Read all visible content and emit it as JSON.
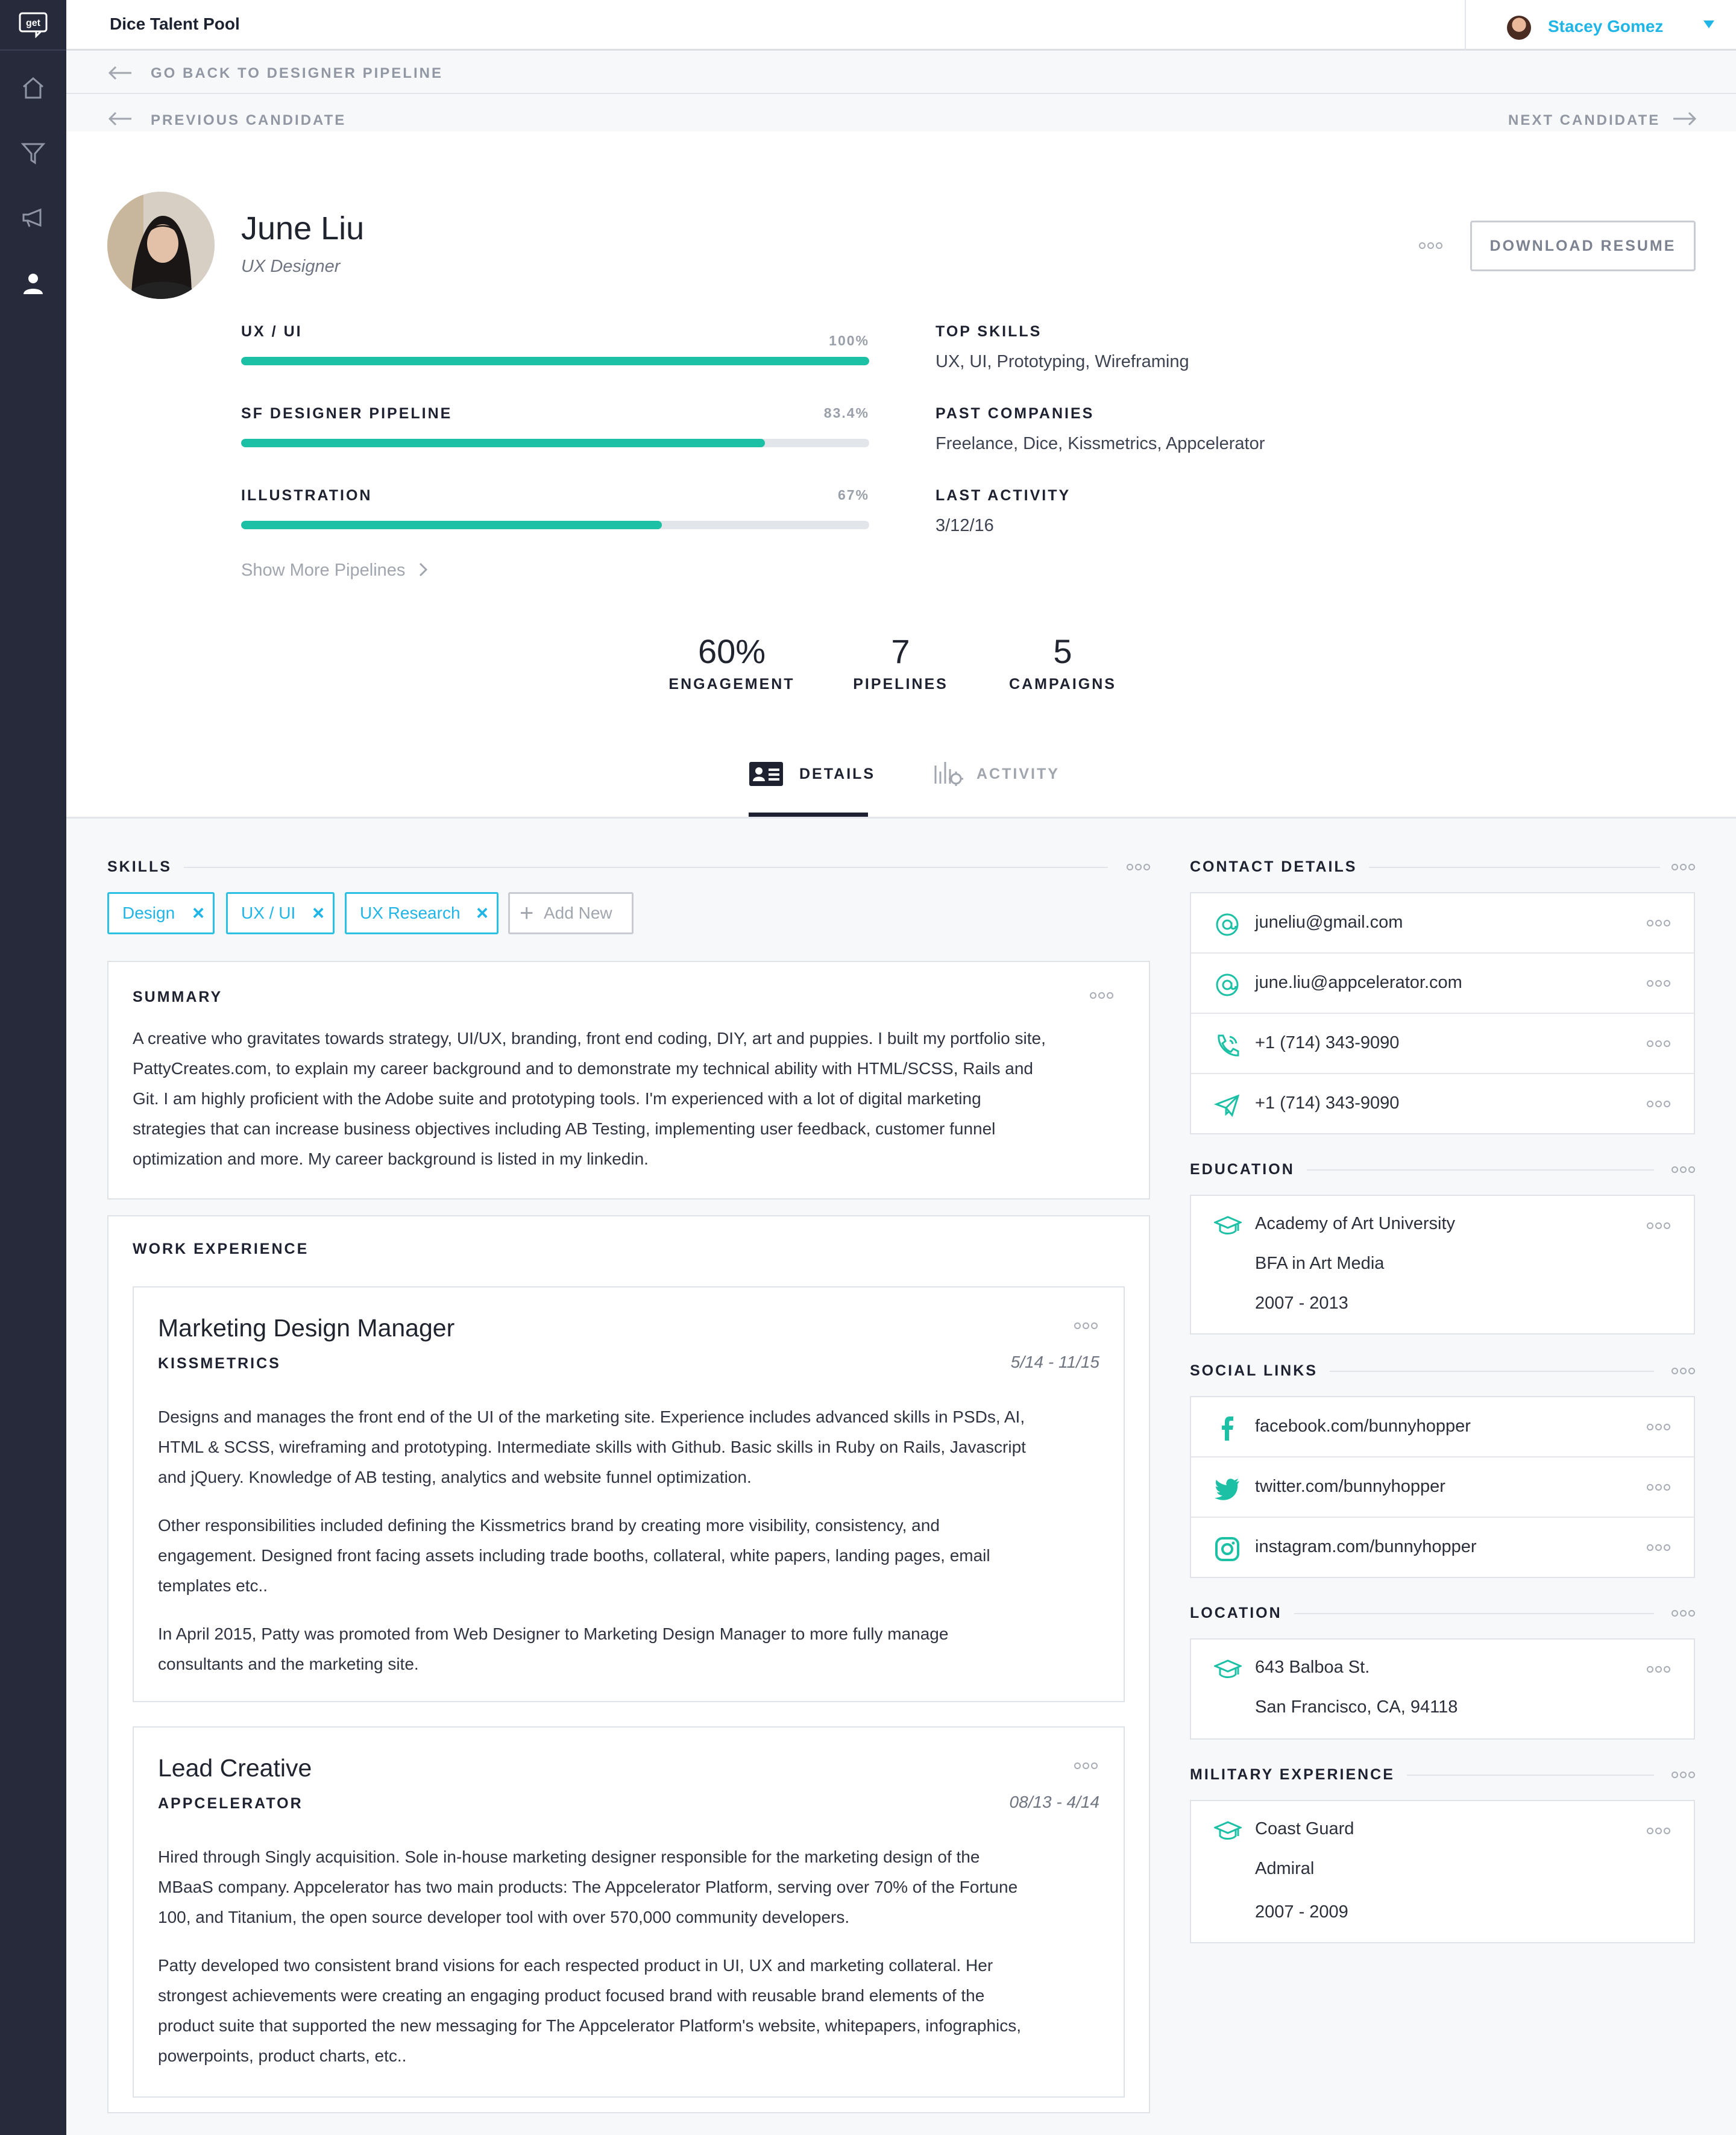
{
  "app": {
    "logo": "get",
    "title": "Dice Talent Pool"
  },
  "user": {
    "name": "Stacey Gomez"
  },
  "nav": {
    "back": "GO BACK TO DESIGNER PIPELINE",
    "prev": "PREVIOUS CANDIDATE",
    "next": "NEXT CANDIDATE"
  },
  "sidebar": {
    "items": [
      {
        "icon": "home-icon"
      },
      {
        "icon": "funnel-icon"
      },
      {
        "icon": "megaphone-icon"
      },
      {
        "icon": "person-icon"
      }
    ]
  },
  "candidate": {
    "name": "June Liu",
    "title": "UX Designer"
  },
  "actions": {
    "download": "DOWNLOAD RESUME"
  },
  "pipelines": [
    {
      "label": "UX / UI",
      "pct_text": "100%",
      "value": 100
    },
    {
      "label": "SF DESIGNER PIPELINE",
      "pct_text": "83.4%",
      "value": 83.4
    },
    {
      "label": "ILLUSTRATION",
      "pct_text": "67%",
      "value": 67
    }
  ],
  "show_more": "Show More Pipelines",
  "info": [
    {
      "label": "TOP SKILLS",
      "value": "UX, UI, Prototyping, Wireframing"
    },
    {
      "label": "PAST COMPANIES",
      "value": "Freelance, Dice, Kissmetrics, Appcelerator"
    },
    {
      "label": "LAST ACTIVITY",
      "value": "3/12/16"
    }
  ],
  "stats": [
    {
      "num": "60%",
      "label": "ENGAGEMENT"
    },
    {
      "num": "7",
      "label": "PIPELINES"
    },
    {
      "num": "5",
      "label": "CAMPAIGNS"
    }
  ],
  "tabs": [
    {
      "label": "DETAILS",
      "active": true
    },
    {
      "label": "ACTIVITY",
      "active": false
    }
  ],
  "skills": {
    "title": "SKILLS",
    "tags": [
      "Design",
      "UX / UI",
      "UX Research"
    ],
    "add": "Add New"
  },
  "summary": {
    "title": "SUMMARY",
    "lines": [
      "A creative who gravitates towards strategy, UI/UX, branding, front end coding, DIY, art and puppies. I built my portfolio site,",
      "PattyCreates.com, to explain my career background and to demonstrate my technical ability with HTML/SCSS, Rails and",
      "Git. I am highly proficient with the Adobe suite and prototyping tools. I'm experienced with a lot of digital marketing",
      "strategies that can increase business objectives including AB Testing, implementing user feedback, customer funnel",
      "optimization and more. My career background is listed in my linkedin."
    ]
  },
  "work": {
    "title": "WORK EXPERIENCE",
    "jobs": [
      {
        "title": "Marketing Design Manager",
        "company": "KISSMETRICS",
        "dates": "5/14 - 11/15",
        "paras": [
          [
            "Designs and manages the front end of the UI of the marketing site. Experience includes advanced skills in PSDs, AI,",
            "HTML & SCSS, wireframing and prototyping. Intermediate skills with Github. Basic skills in Ruby on Rails, Javascript",
            "and jQuery. Knowledge of AB testing, analytics and website funnel optimization."
          ],
          [
            "Other responsibilities included defining the Kissmetrics brand by creating more visibility, consistency, and",
            "engagement. Designed front facing assets including trade booths, collateral, white papers, landing pages, email",
            "templates etc.."
          ],
          [
            "In April 2015, Patty was promoted from Web Designer to Marketing Design Manager to more fully manage",
            "consultants and the marketing site."
          ]
        ]
      },
      {
        "title": "Lead Creative",
        "company": "APPCELERATOR",
        "dates": "08/13 - 4/14",
        "paras": [
          [
            "Hired through Singly acquisition. Sole in-house marketing designer responsible for the marketing design of the",
            "MBaaS company. Appcelerator has two main products: The Appcelerator Platform, serving over 70% of the Fortune",
            "100, and Titanium, the open source developer tool with over 570,000 community developers."
          ],
          [
            "Patty developed two consistent brand visions for each respected product in UI, UX and marketing collateral. Her",
            "strongest achievements were creating an engaging product focused brand with reusable brand elements of the",
            "product suite that supported the new messaging for The Appcelerator Platform's website, whitepapers, infographics,",
            "powerpoints, product charts, etc.."
          ]
        ]
      }
    ]
  },
  "contact": {
    "title": "CONTACT DETAILS",
    "items": [
      {
        "icon": "at-icon",
        "text": "juneliu@gmail.com"
      },
      {
        "icon": "at-icon",
        "text": "june.liu@appcelerator.com"
      },
      {
        "icon": "phone-icon",
        "text": "+1 (714) 343-9090"
      },
      {
        "icon": "send-icon",
        "text": "+1 (714) 343-9090"
      }
    ]
  },
  "education": {
    "title": "EDUCATION",
    "school": "Academy of Art University",
    "degree": "BFA in Art Media",
    "years": "2007 - 2013"
  },
  "social": {
    "title": "SOCIAL LINKS",
    "items": [
      {
        "icon": "facebook-icon",
        "text": "facebook.com/bunnyhopper"
      },
      {
        "icon": "twitter-icon",
        "text": "twitter.com/bunnyhopper"
      },
      {
        "icon": "instagram-icon",
        "text": "instagram.com/bunnyhopper"
      }
    ]
  },
  "location": {
    "title": "LOCATION",
    "line1": "643 Balboa St.",
    "line2": "San Francisco, CA, 94118"
  },
  "military": {
    "title": "MILITARY EXPERIENCE",
    "branch": "Coast Guard",
    "rank": "Admiral",
    "years": "2007 - 2009"
  },
  "colors": {
    "accent": "#1cc0a5",
    "link": "#1fb5e6",
    "sidebar": "#262a3b"
  }
}
